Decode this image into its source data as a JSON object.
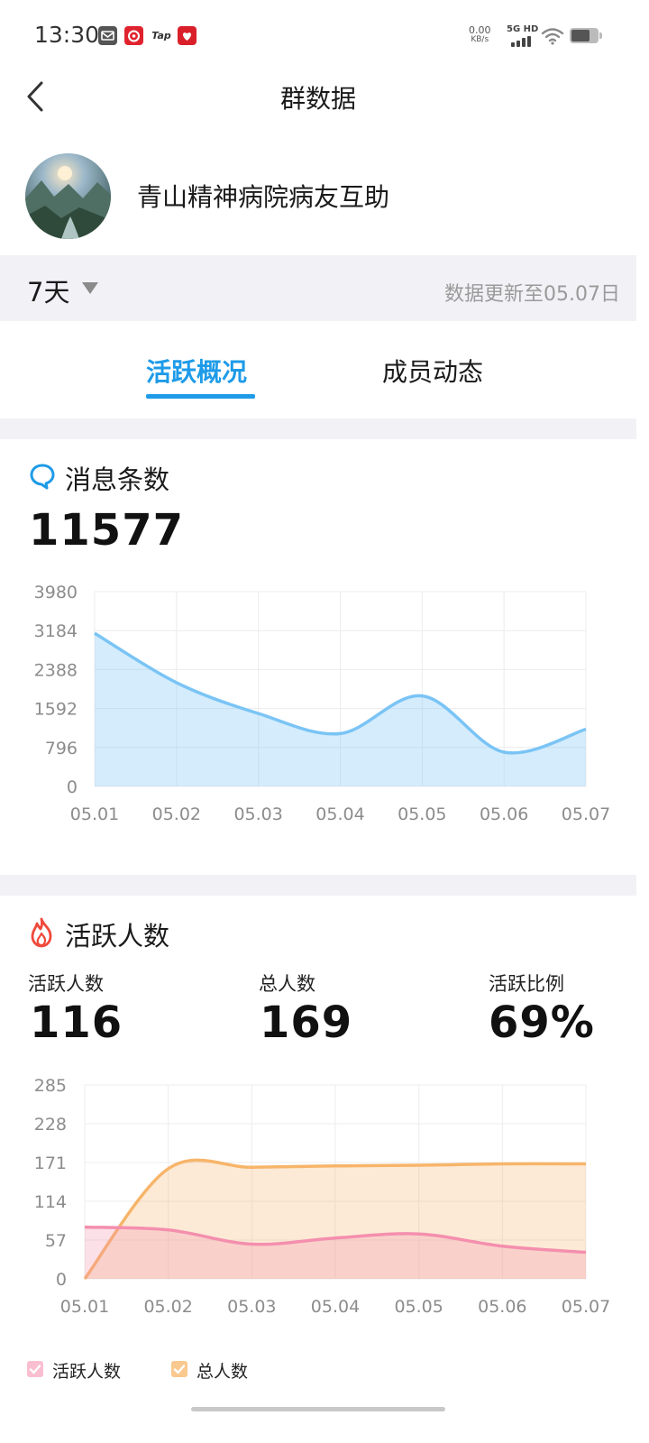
{
  "status_bar": {
    "time": "13:30",
    "net_speed_value": "0.00",
    "net_speed_unit": "KB/s",
    "network": "5G HD",
    "notification_icons": [
      "mail-icon",
      "netease-music-icon",
      "taptap-icon",
      "red-app-icon"
    ],
    "tap_text": "Tap"
  },
  "header": {
    "title": "群数据",
    "back_icon": "chevron-left-icon"
  },
  "group": {
    "name": "青山精神病院病友互助"
  },
  "filter": {
    "period": "7天",
    "update_text": "数据更新至05.07日"
  },
  "tabs": [
    {
      "label": "活跃概况",
      "active": true
    },
    {
      "label": "成员动态",
      "active": false
    }
  ],
  "messages": {
    "title": "消息条数",
    "total": "11577",
    "icon": "chat-bubble-icon",
    "accent": "#1e9be8"
  },
  "active": {
    "title": "活跃人数",
    "icon": "flame-icon",
    "stats": [
      {
        "label": "活跃人数",
        "value": "116"
      },
      {
        "label": "总人数",
        "value": "169"
      },
      {
        "label": "活跃比例",
        "value": "69%"
      }
    ],
    "legend": [
      {
        "label": "活跃人数",
        "color": "#f48fae"
      },
      {
        "label": "总人数",
        "color": "#f7b56a"
      }
    ]
  },
  "chart_data": [
    {
      "type": "area",
      "categories": [
        "05.01",
        "05.02",
        "05.03",
        "05.04",
        "05.05",
        "05.06",
        "05.07"
      ],
      "series": [
        {
          "values": [
            3130,
            2120,
            1490,
            1080,
            1850,
            700,
            1170
          ],
          "color": "#7ac4f5"
        }
      ],
      "yticks": [
        0,
        796,
        1592,
        2388,
        3184,
        3980
      ],
      "ylim": [
        0,
        3980
      ],
      "grid": true
    },
    {
      "type": "area",
      "categories": [
        "05.01",
        "05.02",
        "05.03",
        "05.04",
        "05.05",
        "05.06",
        "05.07"
      ],
      "series": [
        {
          "name": "活跃人数",
          "values": [
            76,
            72,
            51,
            60,
            66,
            48,
            39
          ],
          "color": "#f48fae"
        },
        {
          "name": "总人数",
          "values": [
            0,
            162,
            164,
            166,
            167,
            169,
            169
          ],
          "color": "#f7b56a"
        }
      ],
      "yticks": [
        0,
        57,
        114,
        171,
        228,
        285
      ],
      "ylim": [
        0,
        285
      ],
      "grid": true,
      "legend_position": "bottom-left"
    }
  ]
}
